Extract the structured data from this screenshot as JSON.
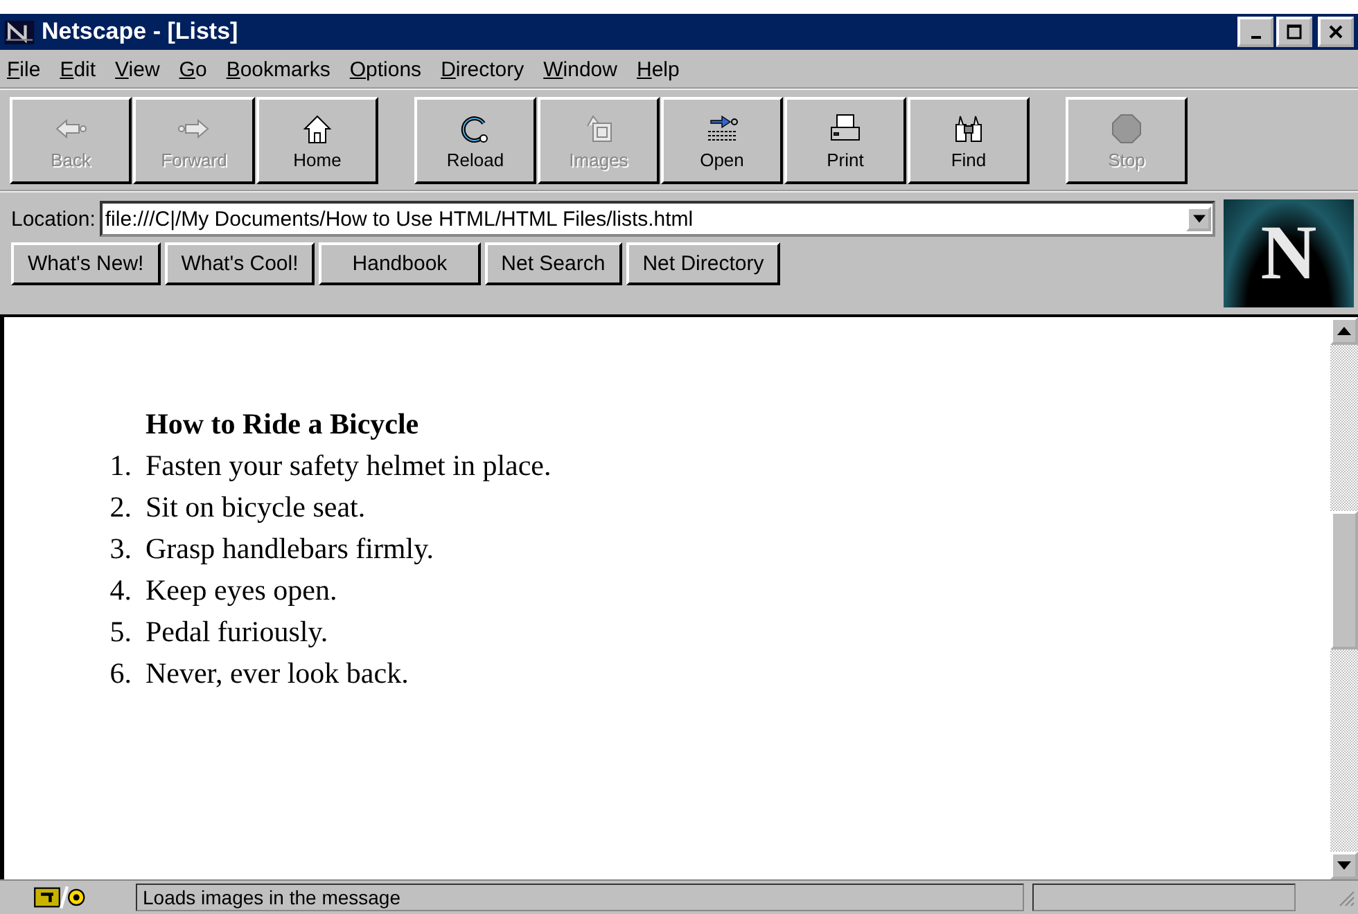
{
  "window": {
    "title": "Netscape - [Lists]"
  },
  "menu": [
    {
      "key": "F",
      "rest": "ile"
    },
    {
      "key": "E",
      "rest": "dit"
    },
    {
      "key": "V",
      "rest": "iew"
    },
    {
      "key": "G",
      "rest": "o"
    },
    {
      "key": "B",
      "rest": "ookmarks"
    },
    {
      "key": "O",
      "rest": "ptions"
    },
    {
      "key": "D",
      "rest": "irectory"
    },
    {
      "key": "W",
      "rest": "indow"
    },
    {
      "key": "H",
      "rest": "elp"
    }
  ],
  "toolbar_groups": [
    {
      "buttons": [
        {
          "label": "Back",
          "kind": "back",
          "disabled": true
        },
        {
          "label": "Forward",
          "kind": "forward",
          "disabled": true
        },
        {
          "label": "Home",
          "kind": "home",
          "disabled": false
        }
      ]
    },
    {
      "buttons": [
        {
          "label": "Reload",
          "kind": "reload",
          "disabled": false
        },
        {
          "label": "Images",
          "kind": "images",
          "disabled": true
        },
        {
          "label": "Open",
          "kind": "open",
          "disabled": false
        },
        {
          "label": "Print",
          "kind": "print",
          "disabled": false
        },
        {
          "label": "Find",
          "kind": "find",
          "disabled": false
        }
      ]
    },
    {
      "buttons": [
        {
          "label": "Stop",
          "kind": "stop",
          "disabled": true
        }
      ]
    }
  ],
  "location": {
    "label": "Location:",
    "value": "file:///C|/My Documents/How to Use HTML/HTML Files/lists.html"
  },
  "directory_buttons": [
    "What's New!",
    "What's Cool!",
    "Handbook",
    "Net Search",
    "Net Directory"
  ],
  "logo": "N",
  "content": {
    "heading": "How to Ride a Bicycle",
    "items": [
      {
        "number": "1.",
        "text": "Fasten your safety helmet in place."
      },
      {
        "number": "2.",
        "text": "Sit on bicycle seat."
      },
      {
        "number": "3.",
        "text": "Grasp handlebars firmly."
      },
      {
        "number": "4.",
        "text": "Keep eyes open."
      },
      {
        "number": "5.",
        "text": "Pedal furiously."
      },
      {
        "number": "6.",
        "text": "Never, ever look back."
      }
    ]
  },
  "status_bar": {
    "message": "Loads images in the message"
  }
}
